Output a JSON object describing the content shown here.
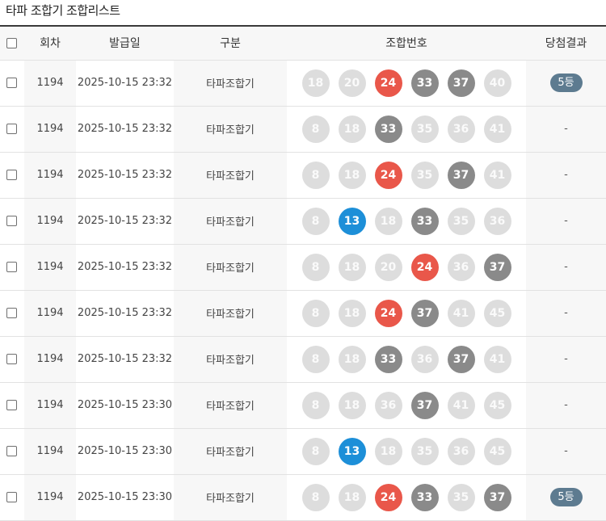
{
  "page": {
    "title": "타파 조합기 조합리스트"
  },
  "table": {
    "headers": {
      "round": "회차",
      "issue_date": "발급일",
      "category": "구분",
      "numbers": "조합번호",
      "result": "당첨결과"
    },
    "rows": [
      {
        "round": "1194",
        "issue_date": "2025-10-15 23:32",
        "category": "타파조합기",
        "balls": [
          {
            "n": "18",
            "c": "gray"
          },
          {
            "n": "20",
            "c": "gray"
          },
          {
            "n": "24",
            "c": "red"
          },
          {
            "n": "33",
            "c": "dark"
          },
          {
            "n": "37",
            "c": "dark"
          },
          {
            "n": "40",
            "c": "gray"
          }
        ],
        "result": "5등"
      },
      {
        "round": "1194",
        "issue_date": "2025-10-15 23:32",
        "category": "타파조합기",
        "balls": [
          {
            "n": "8",
            "c": "gray"
          },
          {
            "n": "18",
            "c": "gray"
          },
          {
            "n": "33",
            "c": "dark"
          },
          {
            "n": "35",
            "c": "gray"
          },
          {
            "n": "36",
            "c": "gray"
          },
          {
            "n": "41",
            "c": "gray"
          }
        ],
        "result": "-"
      },
      {
        "round": "1194",
        "issue_date": "2025-10-15 23:32",
        "category": "타파조합기",
        "balls": [
          {
            "n": "8",
            "c": "gray"
          },
          {
            "n": "18",
            "c": "gray"
          },
          {
            "n": "24",
            "c": "red"
          },
          {
            "n": "35",
            "c": "gray"
          },
          {
            "n": "37",
            "c": "dark"
          },
          {
            "n": "41",
            "c": "gray"
          }
        ],
        "result": "-"
      },
      {
        "round": "1194",
        "issue_date": "2025-10-15 23:32",
        "category": "타파조합기",
        "balls": [
          {
            "n": "8",
            "c": "gray"
          },
          {
            "n": "13",
            "c": "blue"
          },
          {
            "n": "18",
            "c": "gray"
          },
          {
            "n": "33",
            "c": "dark"
          },
          {
            "n": "35",
            "c": "gray"
          },
          {
            "n": "36",
            "c": "gray"
          }
        ],
        "result": "-"
      },
      {
        "round": "1194",
        "issue_date": "2025-10-15 23:32",
        "category": "타파조합기",
        "balls": [
          {
            "n": "8",
            "c": "gray"
          },
          {
            "n": "18",
            "c": "gray"
          },
          {
            "n": "20",
            "c": "gray"
          },
          {
            "n": "24",
            "c": "red"
          },
          {
            "n": "36",
            "c": "gray"
          },
          {
            "n": "37",
            "c": "dark"
          }
        ],
        "result": "-"
      },
      {
        "round": "1194",
        "issue_date": "2025-10-15 23:32",
        "category": "타파조합기",
        "balls": [
          {
            "n": "8",
            "c": "gray"
          },
          {
            "n": "18",
            "c": "gray"
          },
          {
            "n": "24",
            "c": "red"
          },
          {
            "n": "37",
            "c": "dark"
          },
          {
            "n": "41",
            "c": "gray"
          },
          {
            "n": "45",
            "c": "gray"
          }
        ],
        "result": "-"
      },
      {
        "round": "1194",
        "issue_date": "2025-10-15 23:32",
        "category": "타파조합기",
        "balls": [
          {
            "n": "8",
            "c": "gray"
          },
          {
            "n": "18",
            "c": "gray"
          },
          {
            "n": "33",
            "c": "dark"
          },
          {
            "n": "36",
            "c": "gray"
          },
          {
            "n": "37",
            "c": "dark"
          },
          {
            "n": "41",
            "c": "gray"
          }
        ],
        "result": "-"
      },
      {
        "round": "1194",
        "issue_date": "2025-10-15 23:30",
        "category": "타파조합기",
        "balls": [
          {
            "n": "8",
            "c": "gray"
          },
          {
            "n": "18",
            "c": "gray"
          },
          {
            "n": "36",
            "c": "gray"
          },
          {
            "n": "37",
            "c": "dark"
          },
          {
            "n": "41",
            "c": "gray"
          },
          {
            "n": "45",
            "c": "gray"
          }
        ],
        "result": "-"
      },
      {
        "round": "1194",
        "issue_date": "2025-10-15 23:30",
        "category": "타파조합기",
        "balls": [
          {
            "n": "8",
            "c": "gray"
          },
          {
            "n": "13",
            "c": "blue"
          },
          {
            "n": "18",
            "c": "gray"
          },
          {
            "n": "35",
            "c": "gray"
          },
          {
            "n": "36",
            "c": "gray"
          },
          {
            "n": "45",
            "c": "gray"
          }
        ],
        "result": "-"
      },
      {
        "round": "1194",
        "issue_date": "2025-10-15 23:30",
        "category": "타파조합기",
        "balls": [
          {
            "n": "8",
            "c": "gray"
          },
          {
            "n": "18",
            "c": "gray"
          },
          {
            "n": "24",
            "c": "red"
          },
          {
            "n": "33",
            "c": "dark"
          },
          {
            "n": "35",
            "c": "gray"
          },
          {
            "n": "37",
            "c": "dark"
          }
        ],
        "result": "5등"
      }
    ]
  },
  "colors": {
    "gray": "#dddddd",
    "red": "#e9574a",
    "dark": "#8a8a8a",
    "blue": "#1d8fd8",
    "badge": "#5d7b90"
  }
}
